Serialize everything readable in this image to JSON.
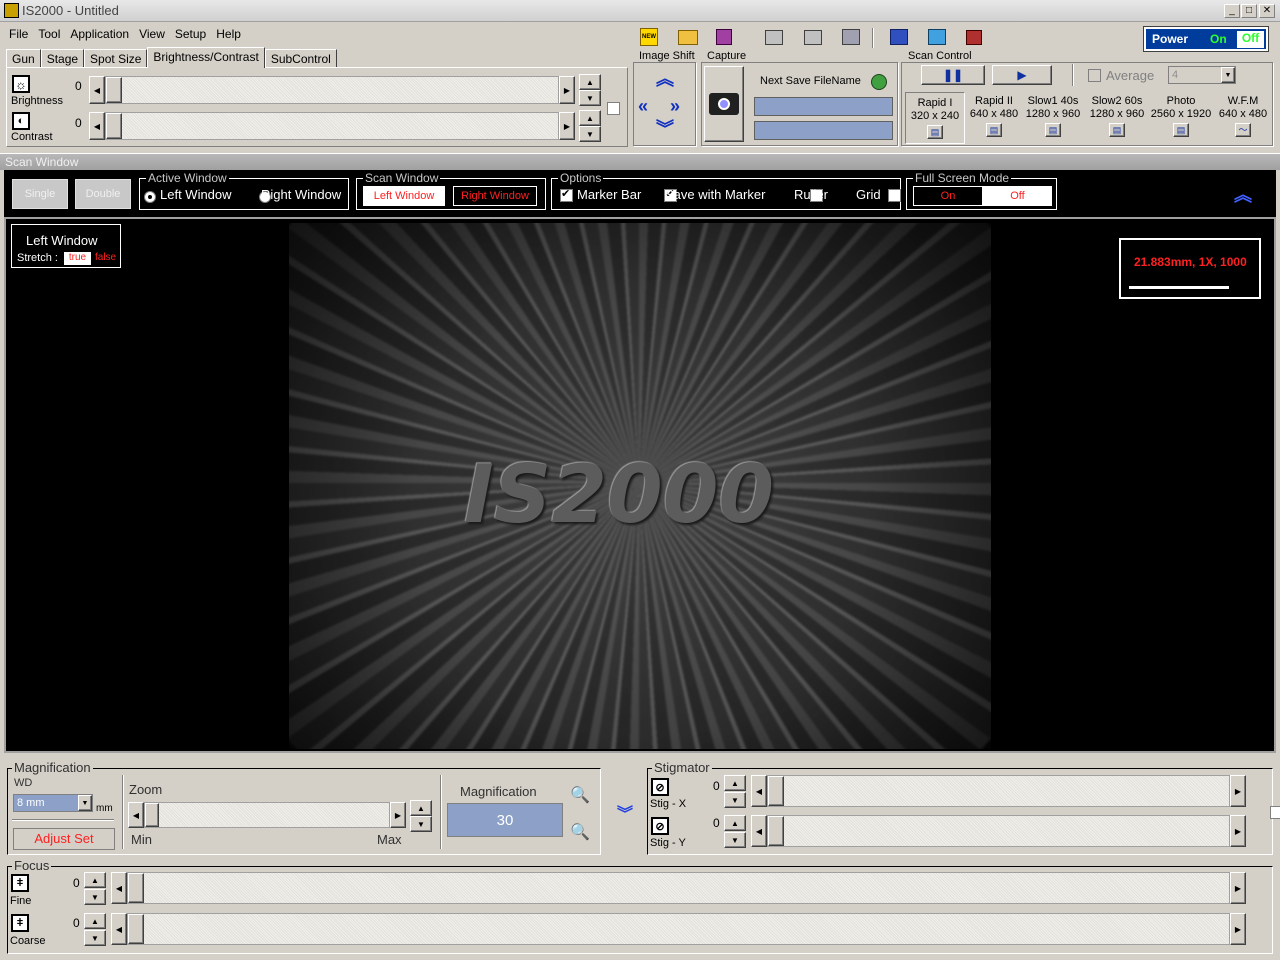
{
  "window": {
    "title": "IS2000 - Untitled"
  },
  "menu": [
    "File",
    "Tool",
    "Application",
    "View",
    "Setup",
    "Help"
  ],
  "tabs": [
    "Gun",
    "Stage",
    "Spot Size",
    "Brightness/Contrast",
    "SubControl"
  ],
  "brightness": {
    "label": "Brightness",
    "value": "0"
  },
  "contrast": {
    "label": "Contrast",
    "value": "0"
  },
  "image_shift": {
    "label": "Image Shift"
  },
  "capture": {
    "label": "Capture",
    "next_save_label": "Next Save FileName"
  },
  "power": {
    "label": "Power",
    "on": "On",
    "off": "Off"
  },
  "scan_control": {
    "label": "Scan Control",
    "average_label": "Average",
    "average_value": "4",
    "modes": [
      {
        "name": "Rapid I",
        "res": "320 x 240"
      },
      {
        "name": "Rapid II",
        "res": "640 x 480"
      },
      {
        "name": "Slow1 40s",
        "res": "1280 x 960"
      },
      {
        "name": "Slow2 60s",
        "res": "1280 x 960"
      },
      {
        "name": "Photo",
        "res": "2560 x 1920"
      },
      {
        "name": "W.F.M",
        "res": "640 x 480"
      }
    ]
  },
  "scan_window": {
    "title": "Scan Window",
    "single": "Single",
    "double": "Double",
    "active_window": {
      "label": "Active Window",
      "left": "Left Window",
      "right": "Right Window"
    },
    "scan_window_group": {
      "label": "Scan Window",
      "left": "Left Window",
      "right": "Right Window"
    },
    "options": {
      "label": "Options",
      "marker_bar": "Marker Bar",
      "save_with_marker": "Save with Marker",
      "ruller": "Ruller",
      "grid": "Grid"
    },
    "full_screen": {
      "label": "Full Screen Mode",
      "on": "On",
      "off": "Off"
    },
    "left_window_label": "Left Window",
    "stretch_label": "Stretch :",
    "stretch_true": "true",
    "stretch_false": "false",
    "marker_text": "21.883mm, 1X, 1000",
    "logo_text": "IS2000"
  },
  "magnification": {
    "group_label": "Magnification",
    "wd_label": "WD",
    "wd_value": "8 mm",
    "wd_unit": "mm",
    "adjust_set": "Adjust Set",
    "zoom_label": "Zoom",
    "zoom_min": "Min",
    "zoom_max": "Max",
    "mag_label": "Magnification",
    "mag_value": "30"
  },
  "stigmator": {
    "label": "Stigmator",
    "x_label": "Stig - X",
    "x_value": "0",
    "y_label": "Stig - Y",
    "y_value": "0"
  },
  "focus": {
    "label": "Focus",
    "fine_label": "Fine",
    "fine_value": "0",
    "coarse_label": "Coarse",
    "coarse_value": "0"
  }
}
